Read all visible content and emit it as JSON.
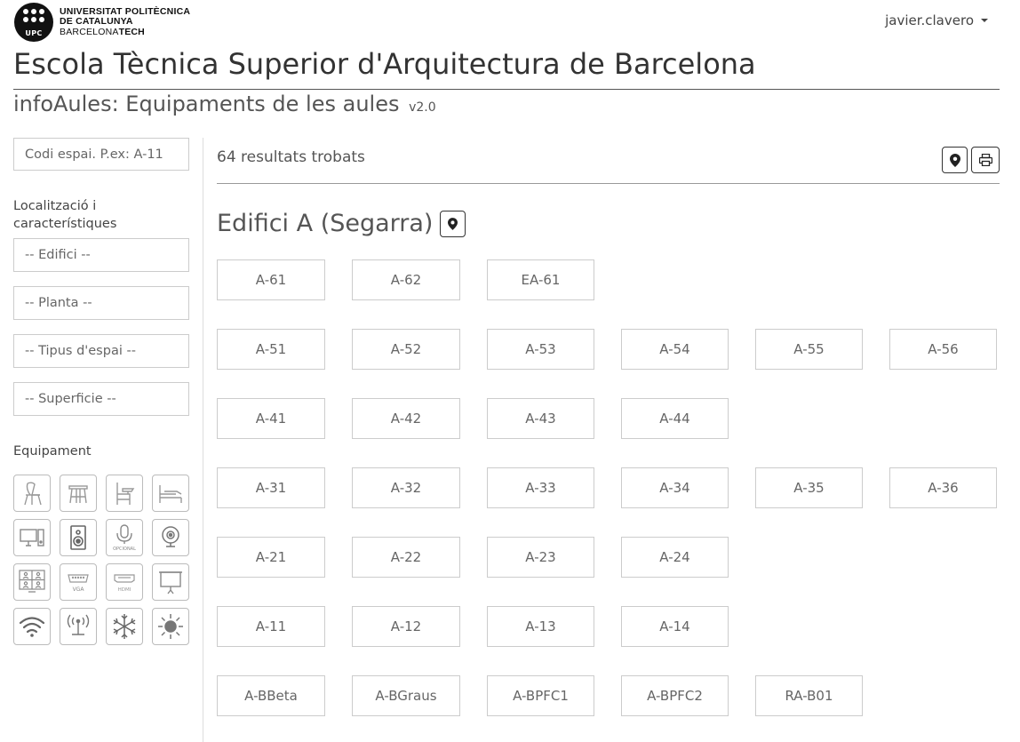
{
  "header": {
    "university_line1": "UNIVERSITAT POLITÈCNICA",
    "university_line2": "DE CATALUNYA",
    "university_line3a": "BARCELONA",
    "university_line3b": "TECH",
    "logo_abbr": "UPC",
    "user": "javier.clavero",
    "school_title": "Escola Tècnica Superior d'Arquitectura de Barcelona",
    "app_title": "infoAules: Equipaments de les aules",
    "app_version": "v2.0"
  },
  "sidebar": {
    "search_placeholder": "Codi espai. P.ex: A-11",
    "location_label": "Localització i característiques",
    "filters": {
      "building": "-- Edifici --",
      "floor": "-- Planta --",
      "space_type": "-- Tipus d'espai --",
      "surface": "-- Superficie --"
    },
    "equipment_label": "Equipament",
    "equipment_icons": [
      "chair-icon",
      "stool-icon",
      "desk-chair-icon",
      "bed-table-icon",
      "computer-icon",
      "speaker-icon",
      "microphone-icon",
      "webcam-icon",
      "videoconference-icon",
      "vga-icon",
      "hdmi-icon",
      "projector-screen-icon",
      "wifi-icon",
      "antenna-icon",
      "snowflake-icon",
      "sun-icon"
    ],
    "equipment_captions": {
      "microphone": "OPCIONAL",
      "vga": "VGA",
      "hdmi": "HDMI"
    }
  },
  "main": {
    "results_text": "64 resultats trobats",
    "building_title": "Edifici A (Segarra)",
    "rows": [
      [
        "A-61",
        "A-62",
        "EA-61"
      ],
      [
        "A-51",
        "A-52",
        "A-53",
        "A-54",
        "A-55",
        "A-56"
      ],
      [
        "A-41",
        "A-42",
        "A-43",
        "A-44"
      ],
      [
        "A-31",
        "A-32",
        "A-33",
        "A-34",
        "A-35",
        "A-36"
      ],
      [
        "A-21",
        "A-22",
        "A-23",
        "A-24"
      ],
      [
        "A-11",
        "A-12",
        "A-13",
        "A-14"
      ],
      [
        "A-BBeta",
        "A-BGraus",
        "A-BPFC1",
        "A-BPFC2",
        "RA-B01"
      ]
    ]
  }
}
